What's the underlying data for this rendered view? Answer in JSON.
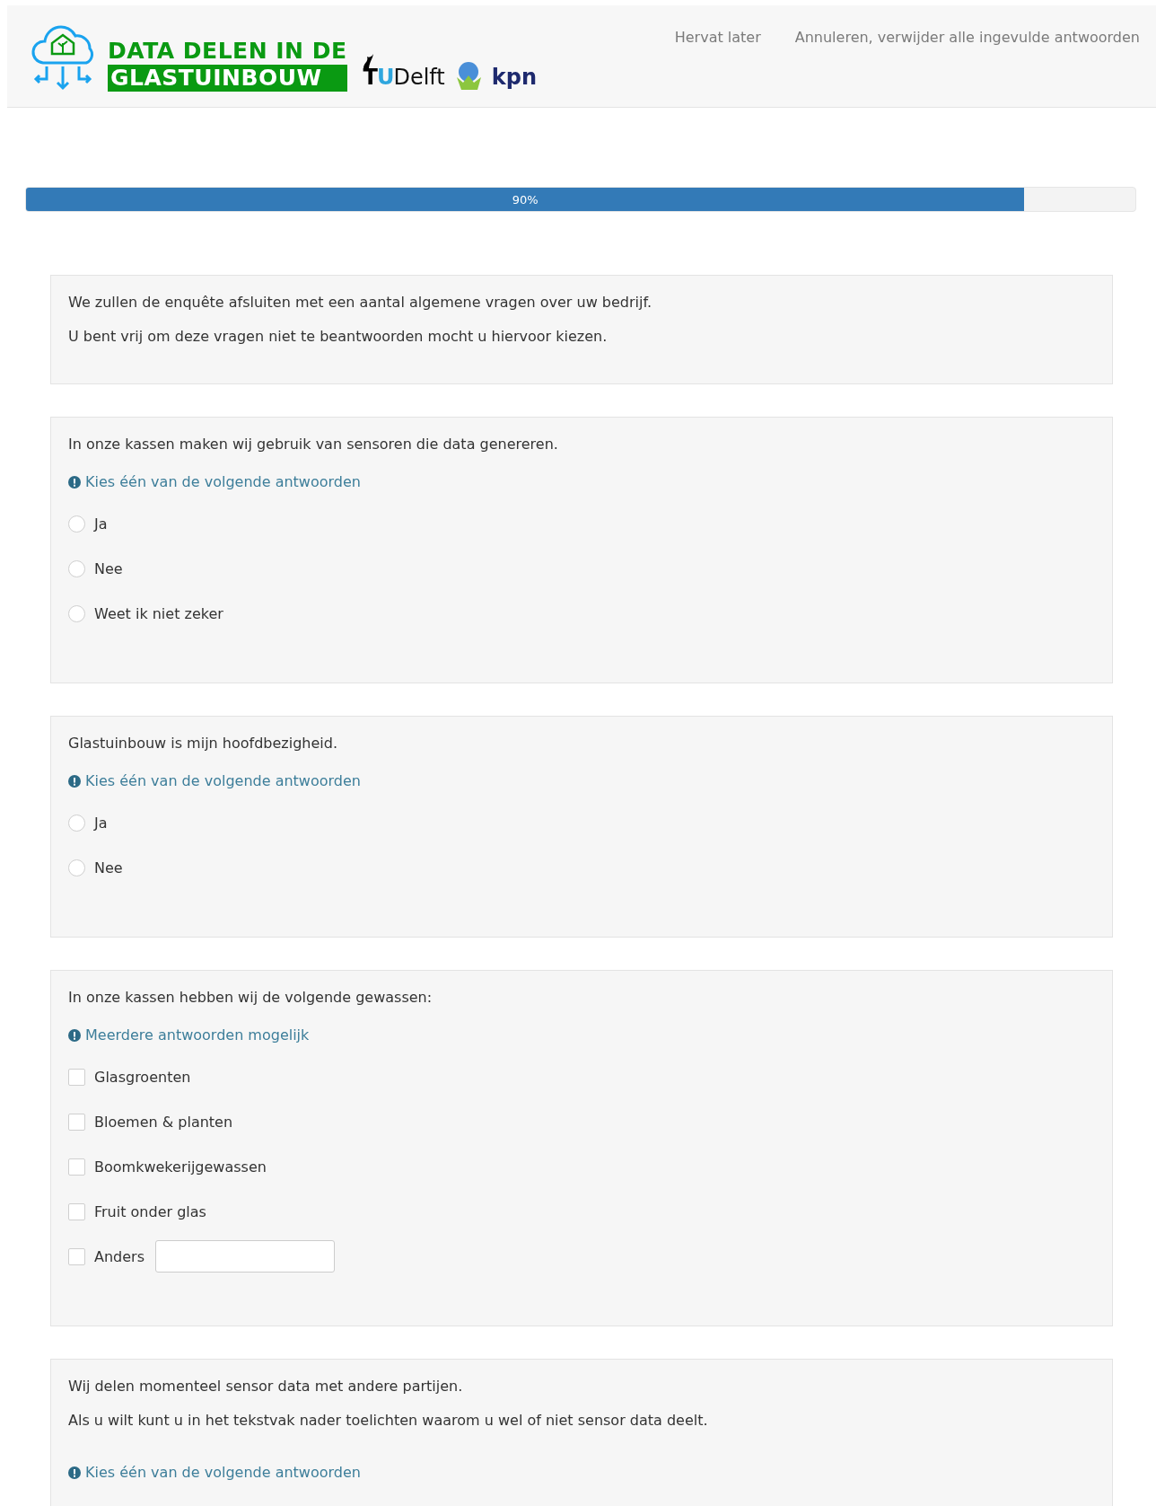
{
  "header": {
    "logo_lines": [
      "DATA DELEN IN DE",
      "GLASTUINBOUW"
    ],
    "tudelft": {
      "mark": "TU",
      "name": "Delft"
    },
    "kpn": "kpn",
    "links": [
      "Hervat later",
      "Annuleren, verwijder alle ingevulde antwoorden"
    ]
  },
  "progress": {
    "level": 0.9,
    "label": "90%"
  },
  "questions": [
    {
      "kind": "info",
      "lines": [
        "We zullen de enquête afsluiten met een aantal algemene vragen over uw bedrijf.",
        "U bent vrij om deze vragen niet te beantwoorden mocht u hiervoor kiezen."
      ]
    },
    {
      "kind": "radio",
      "lines": [
        "In onze kassen maken wij gebruik van sensoren die data genereren."
      ],
      "hint": "Kies één van de volgende antwoorden",
      "options": [
        {
          "label": "Ja",
          "selected": false
        },
        {
          "label": "Nee",
          "selected": false
        },
        {
          "label": "Weet ik niet zeker",
          "selected": false
        }
      ]
    },
    {
      "kind": "radio",
      "lines": [
        "Glastuinbouw is mijn hoofdbezigheid."
      ],
      "hint": "Kies één van de volgende antwoorden",
      "options": [
        {
          "label": "Ja",
          "selected": false
        },
        {
          "label": "Nee",
          "selected": false
        }
      ]
    },
    {
      "kind": "checkbox",
      "lines": [
        "In onze kassen hebben wij de volgende gewassen:"
      ],
      "hint": "Meerdere antwoorden mogelijk",
      "options": [
        {
          "label": "Glasgroenten",
          "checked": false
        },
        {
          "label": "Bloemen & planten",
          "checked": false
        },
        {
          "label": "Boomkwekerijgewassen",
          "checked": false
        },
        {
          "label": "Fruit onder glas",
          "checked": false
        },
        {
          "label": "Anders",
          "checked": false,
          "other": true
        }
      ]
    },
    {
      "kind": "radio",
      "lines": [
        "Wij delen momenteel sensor data met andere partijen.",
        "Als u wilt kunt u in het tekstvak nader toelichten waarom u wel of niet sensor data deelt."
      ],
      "hint": "Kies één van de volgende antwoorden"
    }
  ]
}
